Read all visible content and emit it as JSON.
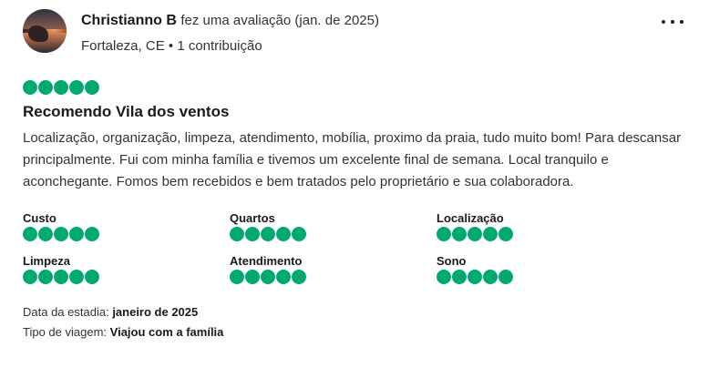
{
  "reviewer": {
    "name": "Christianno B",
    "action": "fez uma avaliação (jan. de 2025)",
    "location": "Fortaleza, CE",
    "separator": "•",
    "contributions": "1 contribuição",
    "avatar_icon": "avatar-photo-icon"
  },
  "menu": {
    "icon": "more-options-icon"
  },
  "review": {
    "rating": 5,
    "max_rating": 5,
    "title": "Recomendo Vila dos ventos",
    "text": "Localização, organização, limpeza, atendimento, mobília, proximo da praia, tudo muito bom! Para descansar principalmente. Fui com minha família e tivemos um excelente final de semana. Local tranquilo e aconchegante. Fomos bem recebidos e bem tratados pelo proprietário e sua colaboradora."
  },
  "subratings": [
    {
      "label": "Custo",
      "rating": 5
    },
    {
      "label": "Quartos",
      "rating": 5
    },
    {
      "label": "Localização",
      "rating": 5
    },
    {
      "label": "Limpeza",
      "rating": 5
    },
    {
      "label": "Atendimento",
      "rating": 5
    },
    {
      "label": "Sono",
      "rating": 5
    }
  ],
  "meta": {
    "stay_label": "Data da estadia:",
    "stay_value": "janeiro de 2025",
    "trip_label": "Tipo de viagem:",
    "trip_value": "Viajou com a família"
  },
  "colors": {
    "bubble_fill": "#00aa6c",
    "text_primary": "#1a1a1a",
    "text_secondary": "#333333"
  }
}
